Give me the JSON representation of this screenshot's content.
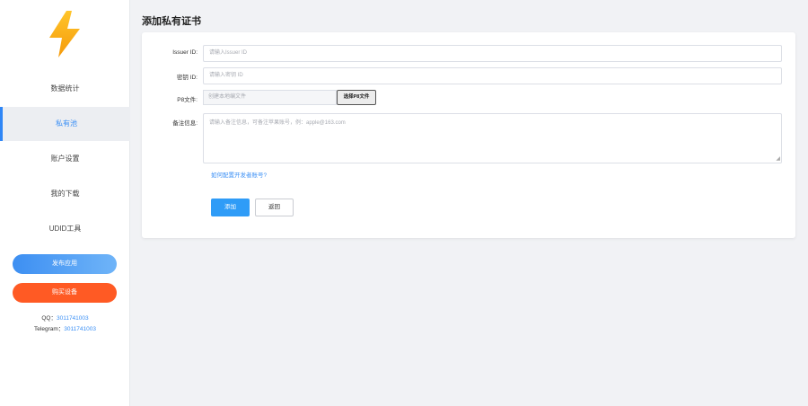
{
  "sidebar": {
    "logo_icon": "lightning-bolt-icon",
    "items": [
      {
        "label": "数据统计"
      },
      {
        "label": "私有池"
      },
      {
        "label": "账户设置"
      },
      {
        "label": "我的下载"
      },
      {
        "label": "UDID工具"
      }
    ],
    "publish_button": "发布应用",
    "buy_button": "购买设备",
    "contact": {
      "qq_label": "QQ：",
      "qq_value": "3011741003",
      "telegram_label": "Telegram：",
      "telegram_value": "3011741003"
    }
  },
  "main": {
    "title": "添加私有证书",
    "form": {
      "issuer_label": "Issuer ID:",
      "issuer_placeholder": "请输入Issuer ID",
      "key_label": "密钥 ID:",
      "key_placeholder": "请输入密钥 ID",
      "p8_label": "P8文件:",
      "p8_placeholder": "创建本地编文件",
      "p8_button": "选择P8文件",
      "note_label": "备注信息:",
      "note_placeholder": "请输入备注信息，可备注苹果账号，例：apple@163.com",
      "help_link": "如何配置开发者账号?",
      "submit_button": "添加",
      "back_button": "返回"
    }
  },
  "colors": {
    "accent": "#2f86f6",
    "orange": "#ff5a24",
    "logo_top": "#ffc52a",
    "logo_bottom": "#f59a0b"
  }
}
